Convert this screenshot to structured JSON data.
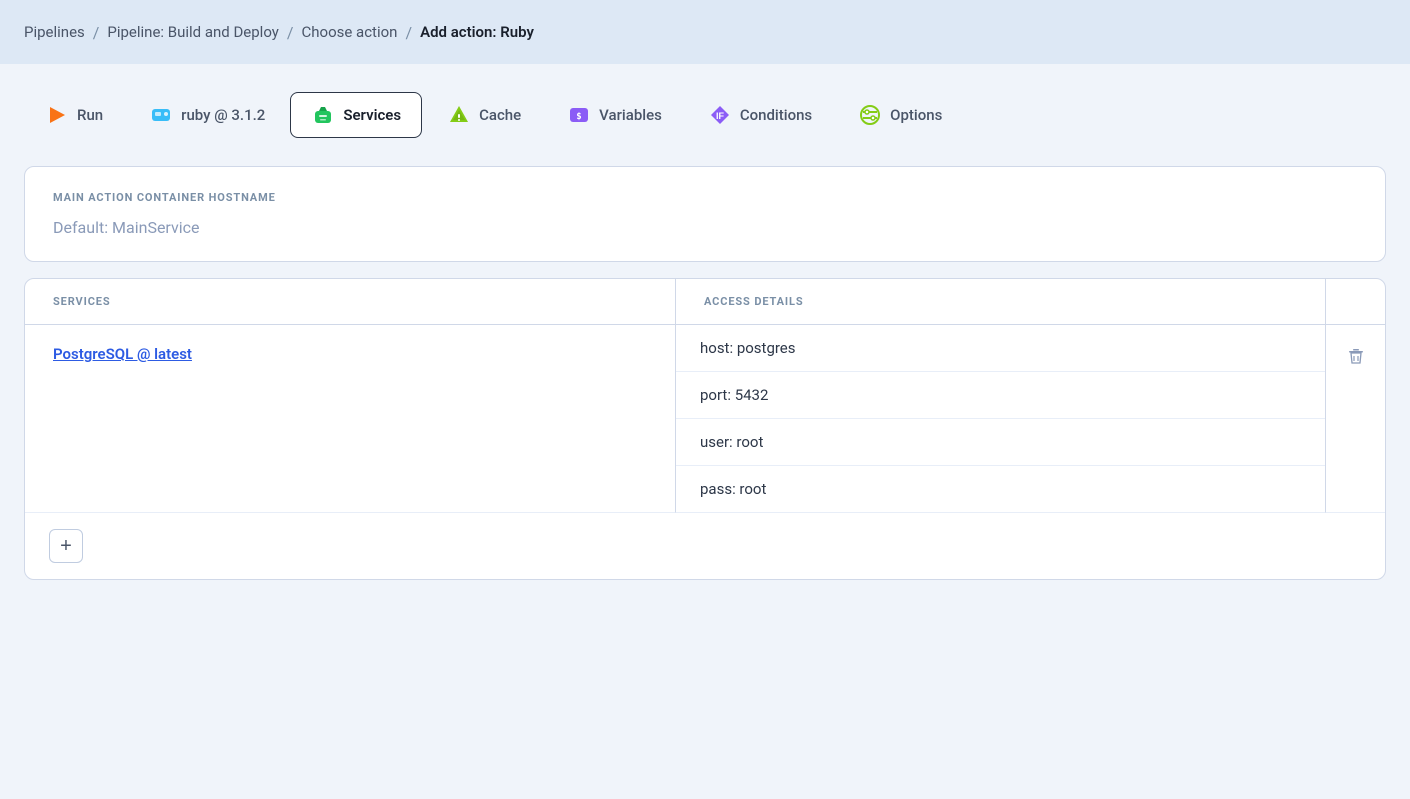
{
  "breadcrumb": {
    "items": [
      {
        "label": "Pipelines",
        "link": true
      },
      {
        "label": "Pipeline: Build and Deploy",
        "link": true
      },
      {
        "label": "Choose action",
        "link": true
      },
      {
        "label": "Add action: Ruby",
        "link": false
      }
    ],
    "separator": "/"
  },
  "tabs": [
    {
      "id": "run",
      "label": "Run",
      "icon": "run-icon",
      "active": false
    },
    {
      "id": "ruby",
      "label": "ruby @ 3.1.2",
      "icon": "ruby-icon",
      "active": false
    },
    {
      "id": "services",
      "label": "Services",
      "icon": "services-icon",
      "active": true
    },
    {
      "id": "cache",
      "label": "Cache",
      "icon": "cache-icon",
      "active": false
    },
    {
      "id": "variables",
      "label": "Variables",
      "icon": "variables-icon",
      "active": false
    },
    {
      "id": "conditions",
      "label": "Conditions",
      "icon": "conditions-icon",
      "active": false
    },
    {
      "id": "options",
      "label": "Options",
      "icon": "options-icon",
      "active": false
    }
  ],
  "hostname_card": {
    "label": "MAIN ACTION CONTAINER HOSTNAME",
    "value": "Default: MainService"
  },
  "services_card": {
    "services_col_header": "SERVICES",
    "access_col_header": "ACCESS DETAILS",
    "rows": [
      {
        "service_name": "PostgreSQL @ latest",
        "access_details": [
          "host: postgres",
          "port: 5432",
          "user: root",
          "pass: root"
        ]
      }
    ],
    "add_button_label": "+"
  }
}
